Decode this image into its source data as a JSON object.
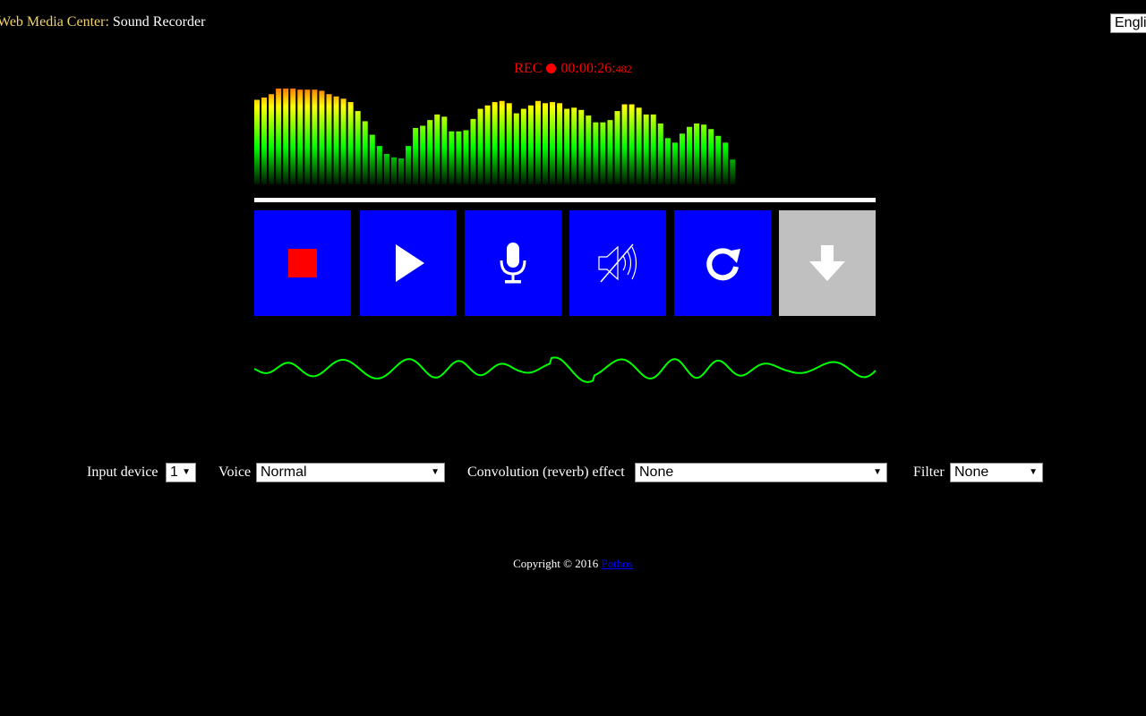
{
  "header": {
    "brand": "Web Media Center",
    "separator": ":",
    "app_name": "Sound Recorder"
  },
  "language": {
    "selected": "English"
  },
  "recording": {
    "label": "REC",
    "time": "00:00:26:",
    "ms": "482",
    "color": "#ff0000"
  },
  "spectrum_levels": [
    0.75,
    0.77,
    0.8,
    0.85,
    0.85,
    0.85,
    0.84,
    0.84,
    0.84,
    0.83,
    0.8,
    0.78,
    0.76,
    0.73,
    0.65,
    0.56,
    0.44,
    0.34,
    0.27,
    0.24,
    0.23,
    0.34,
    0.5,
    0.52,
    0.57,
    0.62,
    0.6,
    0.47,
    0.47,
    0.48,
    0.58,
    0.67,
    0.7,
    0.73,
    0.74,
    0.72,
    0.63,
    0.67,
    0.7,
    0.74,
    0.72,
    0.73,
    0.72,
    0.67,
    0.68,
    0.66,
    0.61,
    0.55,
    0.55,
    0.57,
    0.65,
    0.71,
    0.71,
    0.68,
    0.62,
    0.62,
    0.54,
    0.41,
    0.37,
    0.45,
    0.51,
    0.54,
    0.53,
    0.49,
    0.43,
    0.37,
    0.22
  ],
  "controls": [
    {
      "name": "stop-button",
      "icon": "stop-icon",
      "enabled": true
    },
    {
      "name": "play-button",
      "icon": "play-icon",
      "enabled": true
    },
    {
      "name": "microphone-button",
      "icon": "microphone-icon",
      "enabled": true
    },
    {
      "name": "mute-button",
      "icon": "speaker-muted-icon",
      "enabled": true
    },
    {
      "name": "reset-button",
      "icon": "refresh-icon",
      "enabled": true
    },
    {
      "name": "download-button",
      "icon": "download-icon",
      "enabled": false
    }
  ],
  "colors": {
    "control_bg": "#0000ff",
    "control_disabled_bg": "#c0c0c0",
    "waveform": "#00ff00",
    "brand": "#f1d26b",
    "link": "#0000ff"
  },
  "settings": {
    "input_device_label": "Input device",
    "input_device_value": "1",
    "voice_label": "Voice",
    "voice_value": "Normal",
    "reverb_label": "Convolution (reverb) effect",
    "reverb_value": "None",
    "filter_label": "Filter",
    "filter_value": "None"
  },
  "footer": {
    "copyright": "Copyright © 2016",
    "link_text": "Pothos"
  }
}
